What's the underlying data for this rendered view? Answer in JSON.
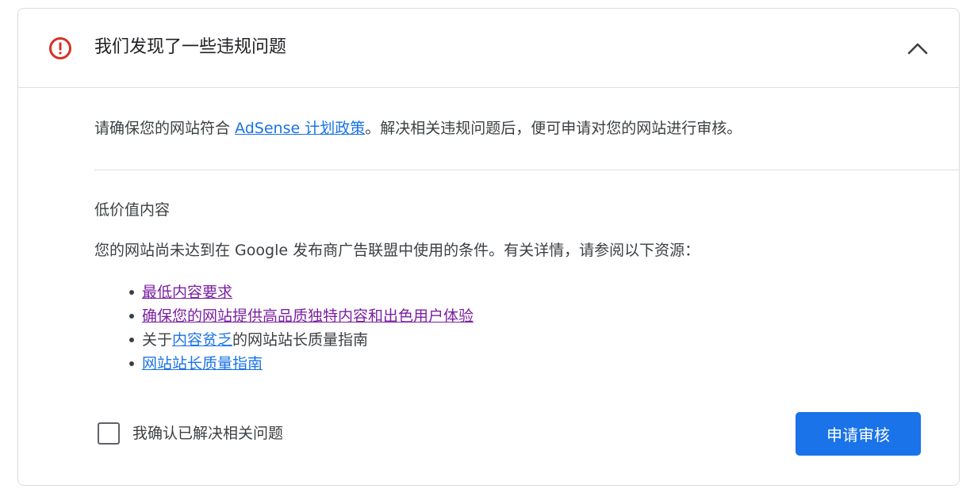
{
  "header": {
    "title": "我们发现了一些违规问题",
    "alert_icon": "error-circle-icon",
    "collapse_icon": "chevron-up-icon"
  },
  "intro": {
    "before": "请确保您的网站符合 ",
    "link": "AdSense 计划政策",
    "after": "。解决相关违规问题后，便可申请对您的网站进行审核。"
  },
  "section": {
    "title": "低价值内容",
    "description": "您的网站尚未达到在 Google 发布商广告联盟中使用的条件。有关详情，请参阅以下资源："
  },
  "resources": {
    "item1": "最低内容要求",
    "item2": "确保您的网站提供高品质独特内容和出色用户体验",
    "item3_before": "关于",
    "item3_link": "内容贫乏",
    "item3_after": "的网站站长质量指南",
    "item4": "网站站长质量指南"
  },
  "footer": {
    "checkbox_label": "我确认已解决相关问题",
    "checkbox_checked": false,
    "review_button": "申请审核"
  },
  "colors": {
    "alert_red": "#d93025",
    "link_blue": "#1a73e8",
    "link_visited": "#7b1fa2",
    "primary_button": "#1a73e8"
  }
}
